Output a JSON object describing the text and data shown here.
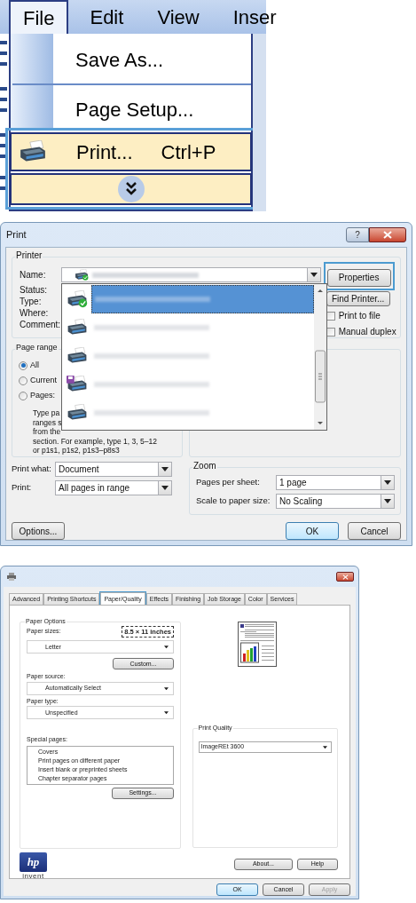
{
  "menu": {
    "bar": [
      {
        "label": "File",
        "selected": true
      },
      {
        "label": "Edit",
        "selected": false
      },
      {
        "label": "View",
        "selected": false
      },
      {
        "label": "Inser",
        "selected": false
      }
    ],
    "items": [
      {
        "kind": "item",
        "label": "Save As...",
        "highlighted": false
      },
      {
        "kind": "separator"
      },
      {
        "kind": "item",
        "label": "Page Setup...",
        "highlighted": false
      },
      {
        "kind": "print_item",
        "label": "Print...",
        "shortcut": "Ctrl+P",
        "highlighted": true
      },
      {
        "kind": "expand",
        "highlighted": true
      }
    ],
    "callout": true
  },
  "print_dialog": {
    "title": "Print",
    "help_button": "?",
    "printer_group": {
      "legend": "Printer",
      "name_label": "Name:",
      "info_labels": [
        "Status:",
        "Type:",
        "Where:",
        "Comment:"
      ],
      "dropdown_open": true,
      "printers": [
        {
          "kind": "default",
          "selected": true
        },
        {
          "kind": "printer",
          "selected": false
        },
        {
          "kind": "printer",
          "selected": false
        },
        {
          "kind": "file",
          "selected": false
        },
        {
          "kind": "printer",
          "selected": false
        }
      ],
      "properties_button": {
        "label": "Properties",
        "callout": true
      },
      "find_button": "Find Printer...",
      "checkboxes": [
        {
          "label": "Print to file",
          "checked": false
        },
        {
          "label": "Manual duplex",
          "checked": false
        }
      ]
    },
    "page_range": {
      "legend": "Page range",
      "options": [
        {
          "label": "All",
          "selected": true
        },
        {
          "label": "Current",
          "selected": false
        },
        {
          "label": "Pages:",
          "selected": false
        }
      ],
      "hint_lines": [
        "Type pa",
        "ranges s",
        "from the",
        "section. For example, type 1, 3, 5–12",
        "or p1s1, p1s2, p1s3–p8s3"
      ]
    },
    "print_what": {
      "label": "Print what:",
      "value": "Document"
    },
    "print_range": {
      "label": "Print:",
      "value": "All pages in range"
    },
    "zoom": {
      "legend": "Zoom",
      "rows": [
        {
          "label": "Pages per sheet:",
          "value": "1 page"
        },
        {
          "label": "Scale to paper size:",
          "value": "No Scaling"
        }
      ]
    },
    "options_button": "Options...",
    "buttons": [
      {
        "label": "OK",
        "default": true
      },
      {
        "label": "Cancel",
        "default": false
      }
    ]
  },
  "properties_dialog": {
    "tabs": [
      {
        "label": "Advanced",
        "selected": false,
        "callout": false
      },
      {
        "label": "Printing Shortcuts",
        "selected": false,
        "callout": false
      },
      {
        "label": "Paper/Quality",
        "selected": true,
        "callout": true
      },
      {
        "label": "Effects",
        "selected": false,
        "callout": false
      },
      {
        "label": "Finishing",
        "selected": false,
        "callout": false
      },
      {
        "label": "Job Storage",
        "selected": false,
        "callout": false
      },
      {
        "label": "Color",
        "selected": false,
        "callout": false
      },
      {
        "label": "Services",
        "selected": false,
        "callout": false
      }
    ],
    "paper_options": {
      "legend": "Paper Options",
      "size_label": "Paper sizes:",
      "size_readout": "8.5 × 11 inches",
      "size_value": "Letter",
      "custom_button": "Custom...",
      "source_label": "Paper source:",
      "source_value": "Automatically Select",
      "type_label": "Paper type:",
      "type_value": "Unspecified",
      "special_label": "Special pages:",
      "special_items": [
        "Covers",
        "Print pages on different paper",
        "Insert blank or preprinted sheets",
        "Chapter separator pages"
      ],
      "settings_button": "Settings..."
    },
    "print_quality": {
      "legend": "Print Quality",
      "value": "ImageREt 3600"
    },
    "logo": {
      "text": "hp",
      "tagline": "invent"
    },
    "about_button": "About...",
    "help_button": "Help",
    "buttons": [
      {
        "label": "OK",
        "default": true,
        "disabled": false
      },
      {
        "label": "Cancel",
        "default": false,
        "disabled": false
      },
      {
        "label": "Apply",
        "default": false,
        "disabled": true
      }
    ]
  }
}
